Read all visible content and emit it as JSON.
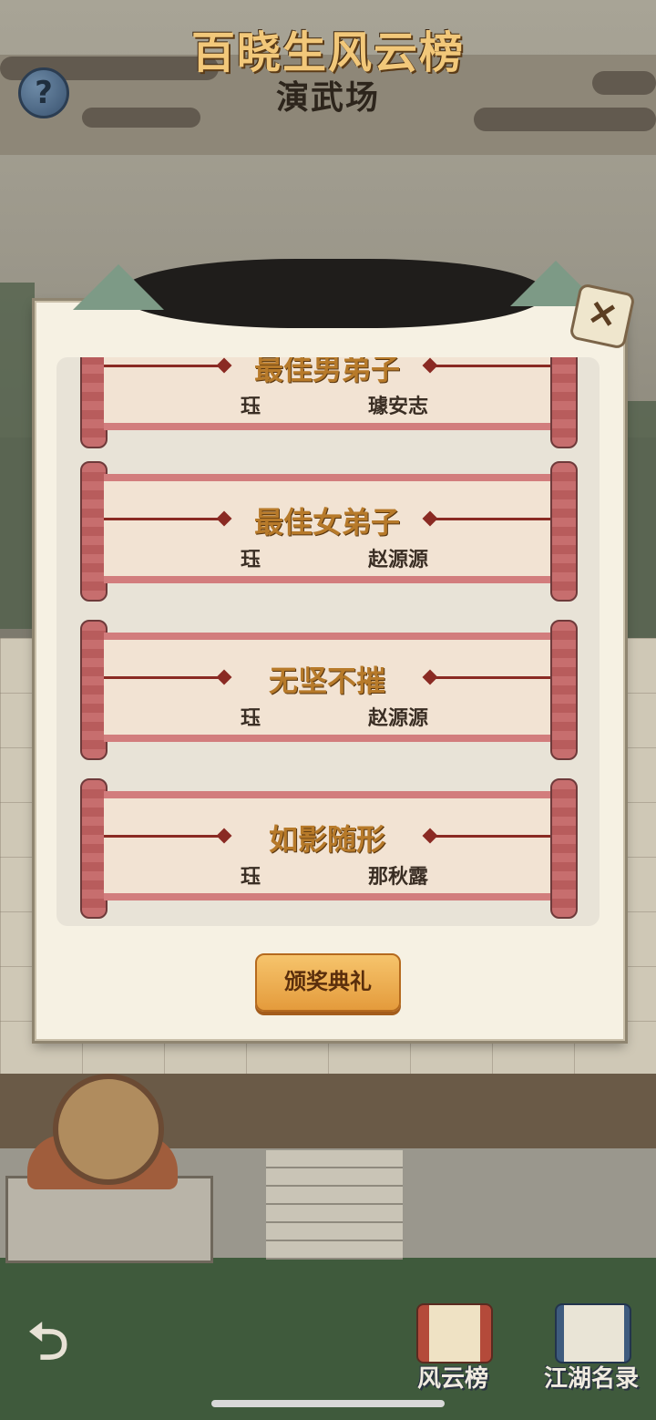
{
  "header": {
    "title": "演武场",
    "help_icon": "?"
  },
  "modal": {
    "title": "百晓生风云榜",
    "close_icon": "✕",
    "awards": [
      {
        "title": "最佳男弟子",
        "winner_a": "珏",
        "winner_b": "璩安志"
      },
      {
        "title": "最佳女弟子",
        "winner_a": "珏",
        "winner_b": "赵源源"
      },
      {
        "title": "无坚不摧",
        "winner_a": "珏",
        "winner_b": "赵源源"
      },
      {
        "title": "如影随形",
        "winner_a": "珏",
        "winner_b": "那秋露"
      }
    ],
    "ceremony_button": "颁奖典礼"
  },
  "bottom_bar": {
    "back_icon": "⮌",
    "nav": [
      {
        "label": "风云榜",
        "icon": "scroll-icon"
      },
      {
        "label": "江湖名录",
        "icon": "book-icon"
      }
    ]
  },
  "colors": {
    "accent": "#f2c87a",
    "scroll_red": "#d27d7d",
    "button_orange": "#e49b3c"
  }
}
